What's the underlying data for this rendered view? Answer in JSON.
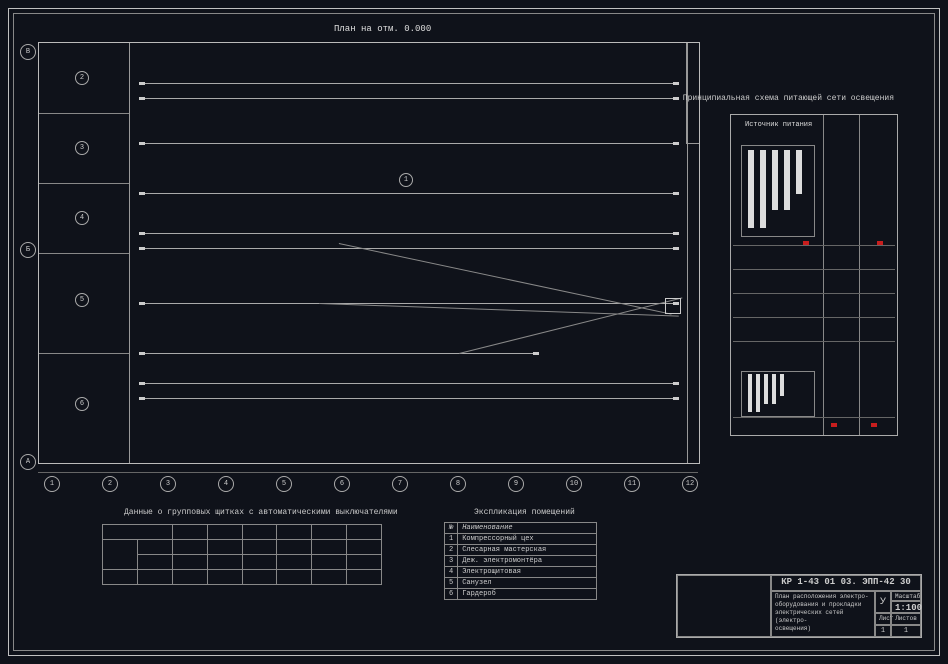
{
  "plan": {
    "title": "План на отм. 0.000",
    "left_rooms": [
      "2",
      "3",
      "4",
      "5",
      "6"
    ],
    "center_label": "1",
    "grid_letters": [
      "А",
      "Б",
      "В"
    ],
    "grid_numbers": [
      "1",
      "2",
      "3",
      "4",
      "5",
      "6",
      "7",
      "8",
      "9",
      "10",
      "11",
      "12"
    ]
  },
  "scheme": {
    "title": "Принципиальная схема питающей сети освещения",
    "source_label": "Источник питания"
  },
  "shield_table": {
    "title": "Данные о групповых щитках с автоматическими выключателями"
  },
  "rooms_table": {
    "title": "Экспликация помещений",
    "head_no": "№",
    "head_name": "Наименование",
    "rows": [
      {
        "no": "1",
        "name": "Компрессорный цех"
      },
      {
        "no": "2",
        "name": "Слесарная мастерская"
      },
      {
        "no": "3",
        "name": "Деж. электромонтёра"
      },
      {
        "no": "4",
        "name": "Электрощитовая"
      },
      {
        "no": "5",
        "name": "Санузел"
      },
      {
        "no": "6",
        "name": "Гардероб"
      }
    ]
  },
  "title_block": {
    "code": "КР 1-43 01 03. ЭПП-42 30",
    "desc1": "План расположения электро-",
    "desc2": "оборудования и прокладки",
    "desc3": "электрических сетей (электро-",
    "desc4": "освещения)",
    "letter": "У",
    "scale_lbl": "Масштаб",
    "scale": "1:100",
    "sheet_lbl": "Лист",
    "sheets_lbl": "Листов",
    "sheet": "1",
    "sheets": "1"
  }
}
